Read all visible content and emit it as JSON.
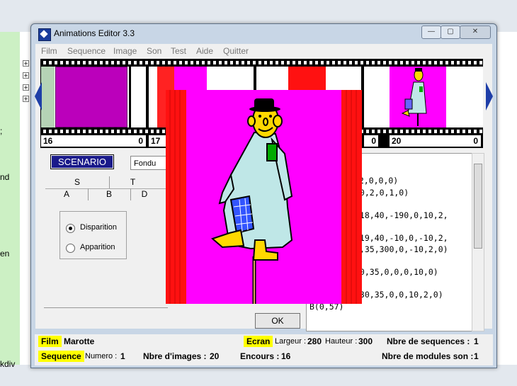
{
  "window": {
    "title": "Animations Editor 3.3",
    "minimize": "—",
    "maximize": "▢",
    "close": "✕"
  },
  "menu": [
    "Film",
    "Sequence",
    "Image",
    "Son",
    "Test",
    "Aide",
    "Quitter"
  ],
  "filmstrip": {
    "frames": [
      {
        "left_num": "16",
        "right_num": "0"
      },
      {
        "left_num": "17",
        "right_num": ""
      },
      {
        "left_num": "",
        "right_num": ""
      },
      {
        "left_num": "",
        "right_num": "0"
      },
      {
        "left_num": "20",
        "right_num": "0"
      }
    ]
  },
  "scenario": {
    "label": "SCENARIO",
    "transition": "Fondu",
    "tabs_row1": [
      "S",
      "T"
    ],
    "tabs_row2": [
      "A",
      "B",
      "D"
    ],
    "radios": [
      {
        "label": "Disparition",
        "checked": true
      },
      {
        "label": "Apparition",
        "checked": false
      }
    ]
  },
  "code_lines": [
    ",-2,0,0,0)",
    ",0,2,0,1,0)",
    ",18,40,-190,0,10,2,",
    ",19,40,-10,0,-10,2,",
    "0,35,300,0,-10,2,0)",
    "10,35,0,0,0,10,0)",
    ",30,35,0,0,10,2,0)",
    "B(0,57)"
  ],
  "ok_button": "OK",
  "status": {
    "film_label": "Film",
    "film_value": "Marotte",
    "ecran_label": "Ecran",
    "largeur_label": "Largeur :",
    "largeur_value": "280",
    "hauteur_label": "Hauteur :",
    "hauteur_value": "300",
    "nbre_sequences_label": "Nbre de sequences :",
    "nbre_sequences_value": "1",
    "sequence_label": "Sequence",
    "numero_label": "Numero :",
    "numero_value": "1",
    "nbre_images_label": "Nbre d'images :",
    "nbre_images_value": "20",
    "encours_label": "Encours :",
    "encours_value": "16",
    "nbre_modules_label": "Nbre de modules son :",
    "nbre_modules_value": "1"
  },
  "background": {
    "frag1": ";",
    "frag2": "nd",
    "frag3": "en",
    "frag4": "kdiv"
  }
}
